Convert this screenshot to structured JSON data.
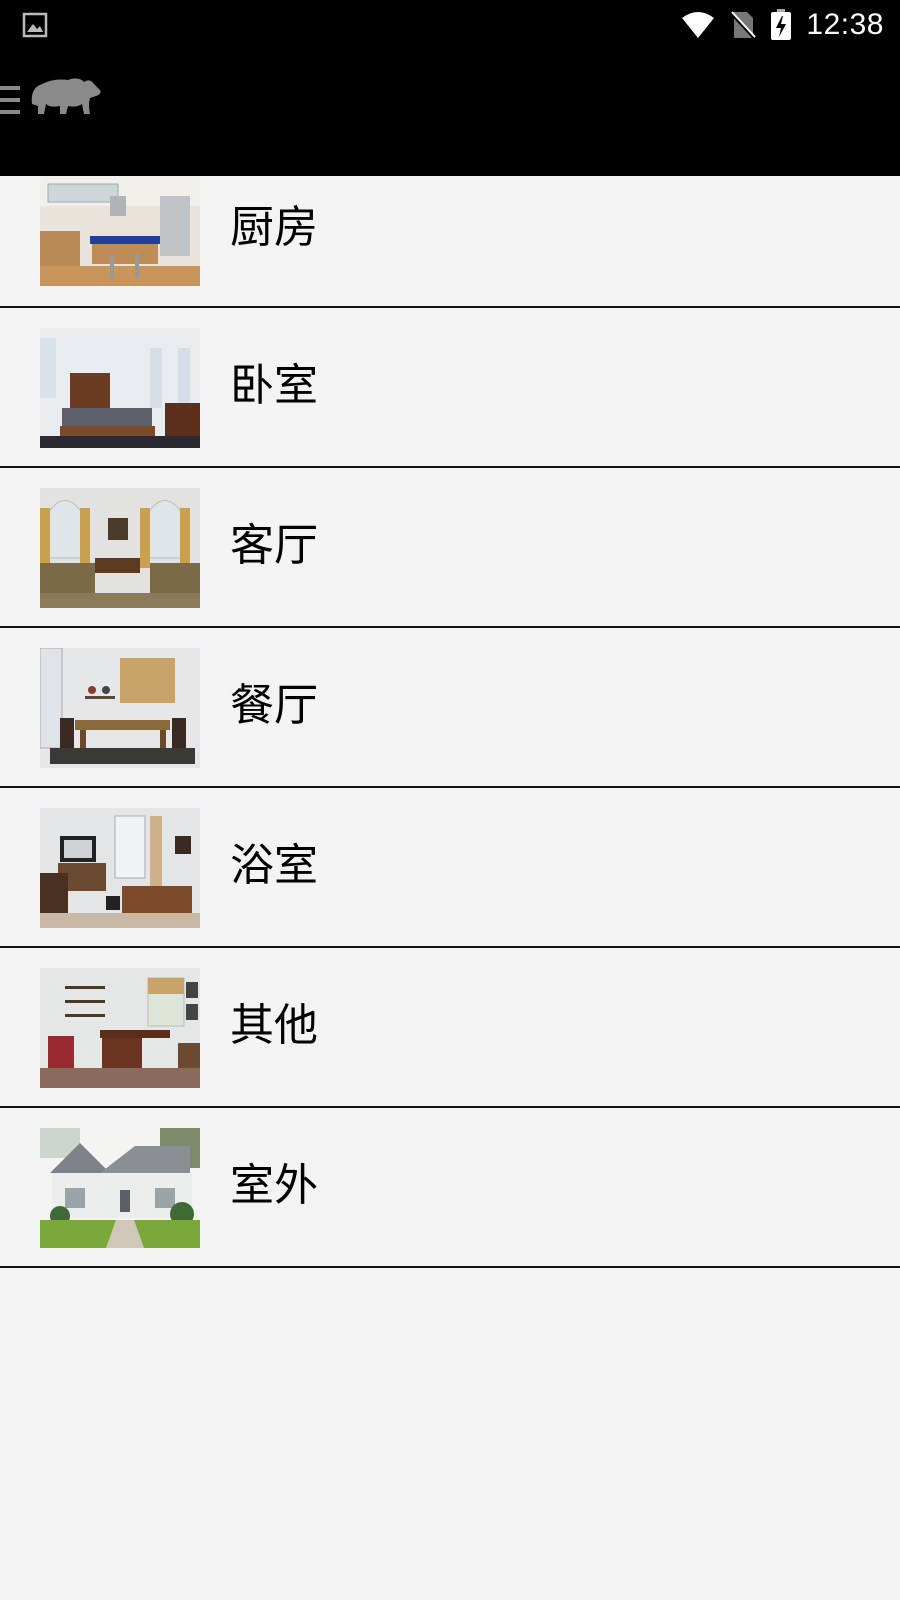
{
  "status_bar": {
    "time": "12:38",
    "icons": [
      "image-notification-icon",
      "wifi-icon",
      "no-sim-icon",
      "battery-charging-icon"
    ]
  },
  "app_bar": {
    "menu_icon": "hamburger-menu-icon",
    "logo_icon": "bear-logo-icon"
  },
  "rooms": [
    {
      "label": "厨房",
      "thumb": "kitchen"
    },
    {
      "label": "卧室",
      "thumb": "bedroom"
    },
    {
      "label": "客厅",
      "thumb": "living-room"
    },
    {
      "label": "餐厅",
      "thumb": "dining-room"
    },
    {
      "label": "浴室",
      "thumb": "bathroom"
    },
    {
      "label": "其他",
      "thumb": "study"
    },
    {
      "label": "室外",
      "thumb": "house-exterior"
    }
  ],
  "colors": {
    "bar_background": "#000000",
    "list_background": "#f3f3f3",
    "divider": "#111111",
    "logo": "#8a8a8a"
  }
}
